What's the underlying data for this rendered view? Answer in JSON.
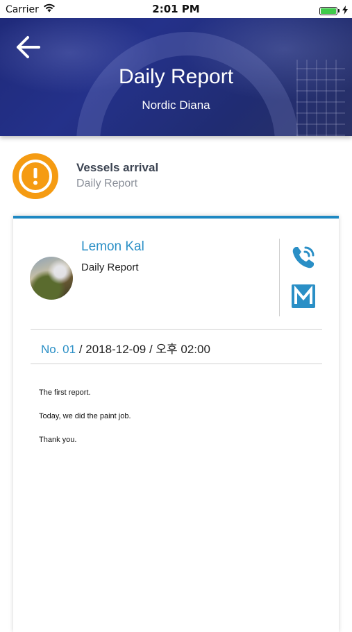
{
  "status_bar": {
    "carrier": "Carrier",
    "time": "2:01 PM",
    "battery_level": 1.0
  },
  "header": {
    "title": "Daily Report",
    "subtitle": "Nordic Diana",
    "back_icon": "arrow-left-icon",
    "background_color": "#24318a"
  },
  "category": {
    "icon": "exclamation-circle-icon",
    "icon_color": "#f59b12",
    "title": "Vessels arrival",
    "subtitle": "Daily Report"
  },
  "card": {
    "accent_color": "#1e88c2",
    "author_name": "Lemon Kal",
    "author_role": "Daily Report",
    "phone_icon": "phone-icon",
    "mail_icon": "mail-icon",
    "number_label": "No. 01",
    "meta_rest": " / 2018-12-09 / 오후 02:00",
    "body": [
      "The first report.",
      "Today, we did the paint job.",
      "Thank you."
    ]
  }
}
